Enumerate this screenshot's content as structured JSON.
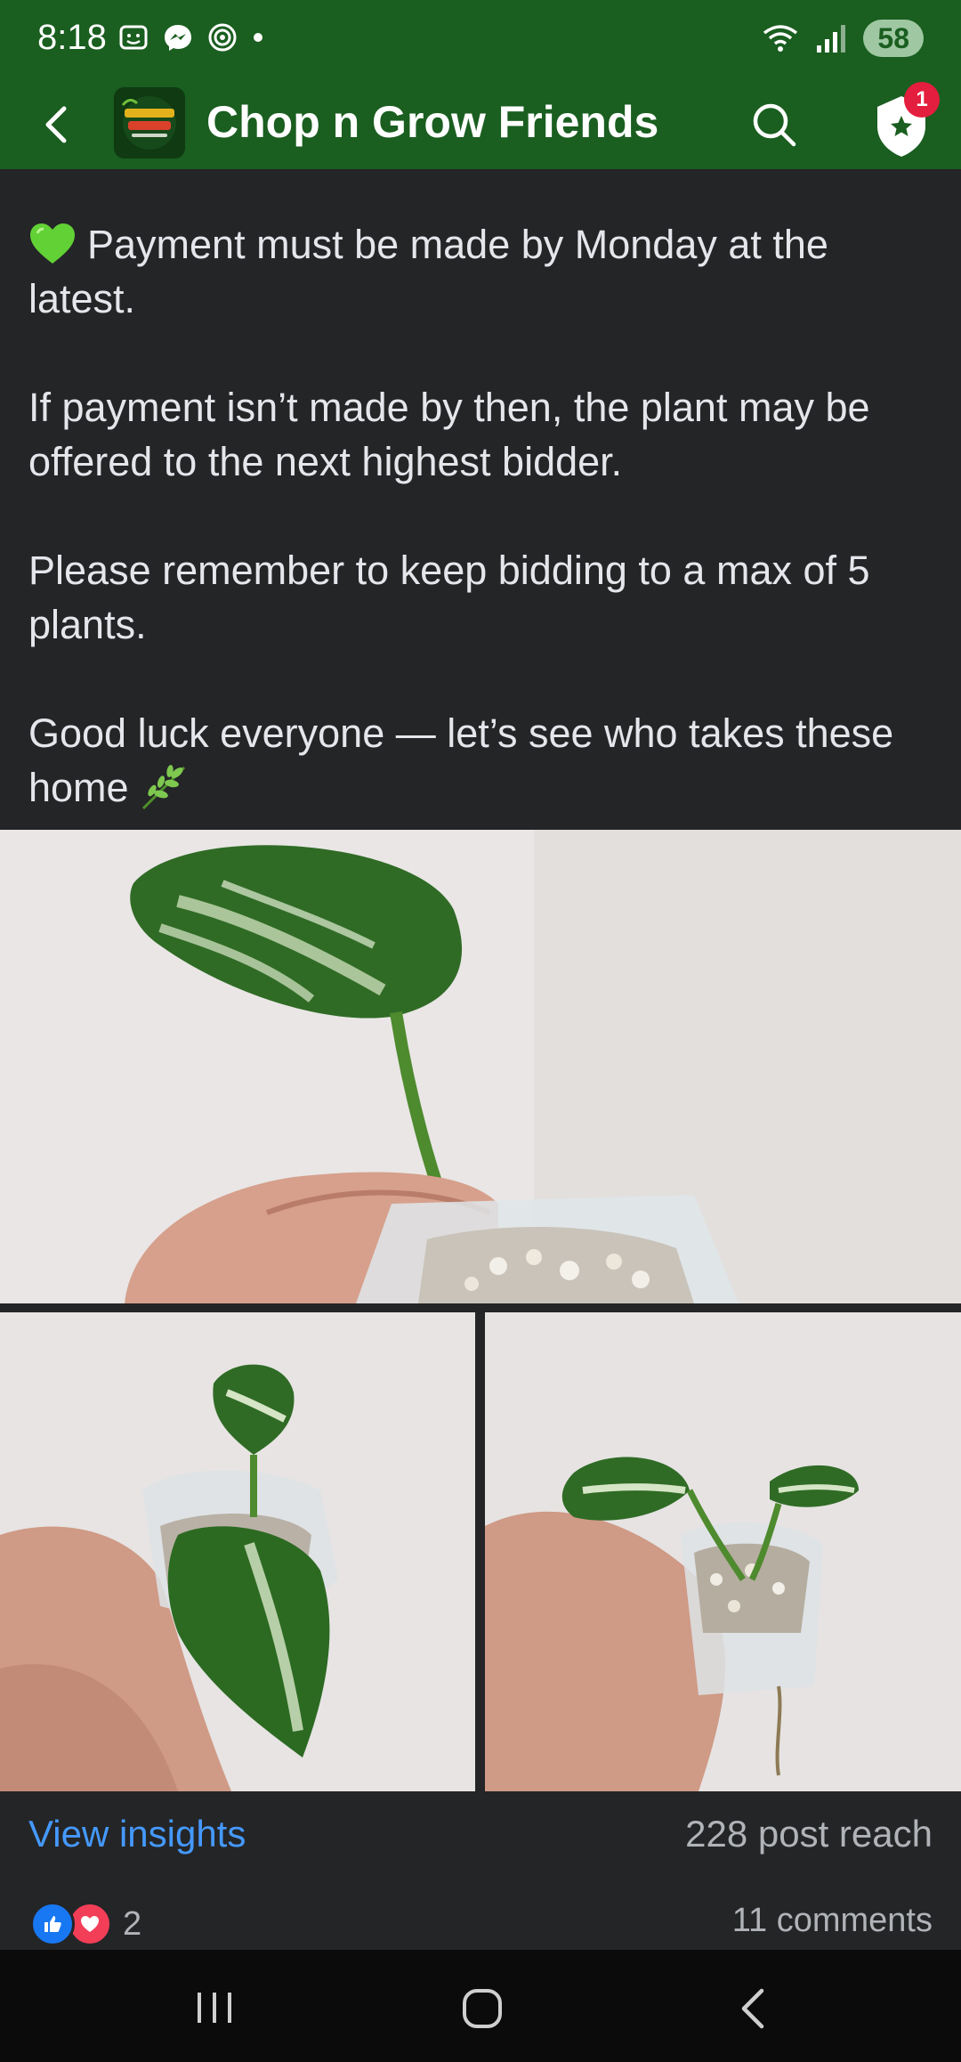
{
  "status_bar": {
    "time": "8:18",
    "battery": "58",
    "icons_left": [
      "screenshot-icon",
      "messenger-icon",
      "threads-icon",
      "dot-icon"
    ],
    "icons_right": [
      "wifi-icon",
      "signal-icon"
    ]
  },
  "header": {
    "title": "Chop n Grow Friends",
    "notification_count": "1",
    "background_color": "#1a5e20"
  },
  "post": {
    "paragraphs": [
      "Payment must be made by Monday at the latest.",
      "If payment isn’t made by then, the plant may be offered to the next highest bidder.",
      "Please remember to keep bidding to a max of 5 plants.",
      "Good luck everyone — let’s see who takes these home"
    ]
  },
  "footer": {
    "insights_label": "View insights",
    "post_reach": "228 post reach",
    "reaction_count": "2",
    "comments": "11 comments"
  },
  "colors": {
    "accent_link": "#4599ff",
    "like_blue": "#1877f2",
    "love_red": "#f33e58"
  }
}
